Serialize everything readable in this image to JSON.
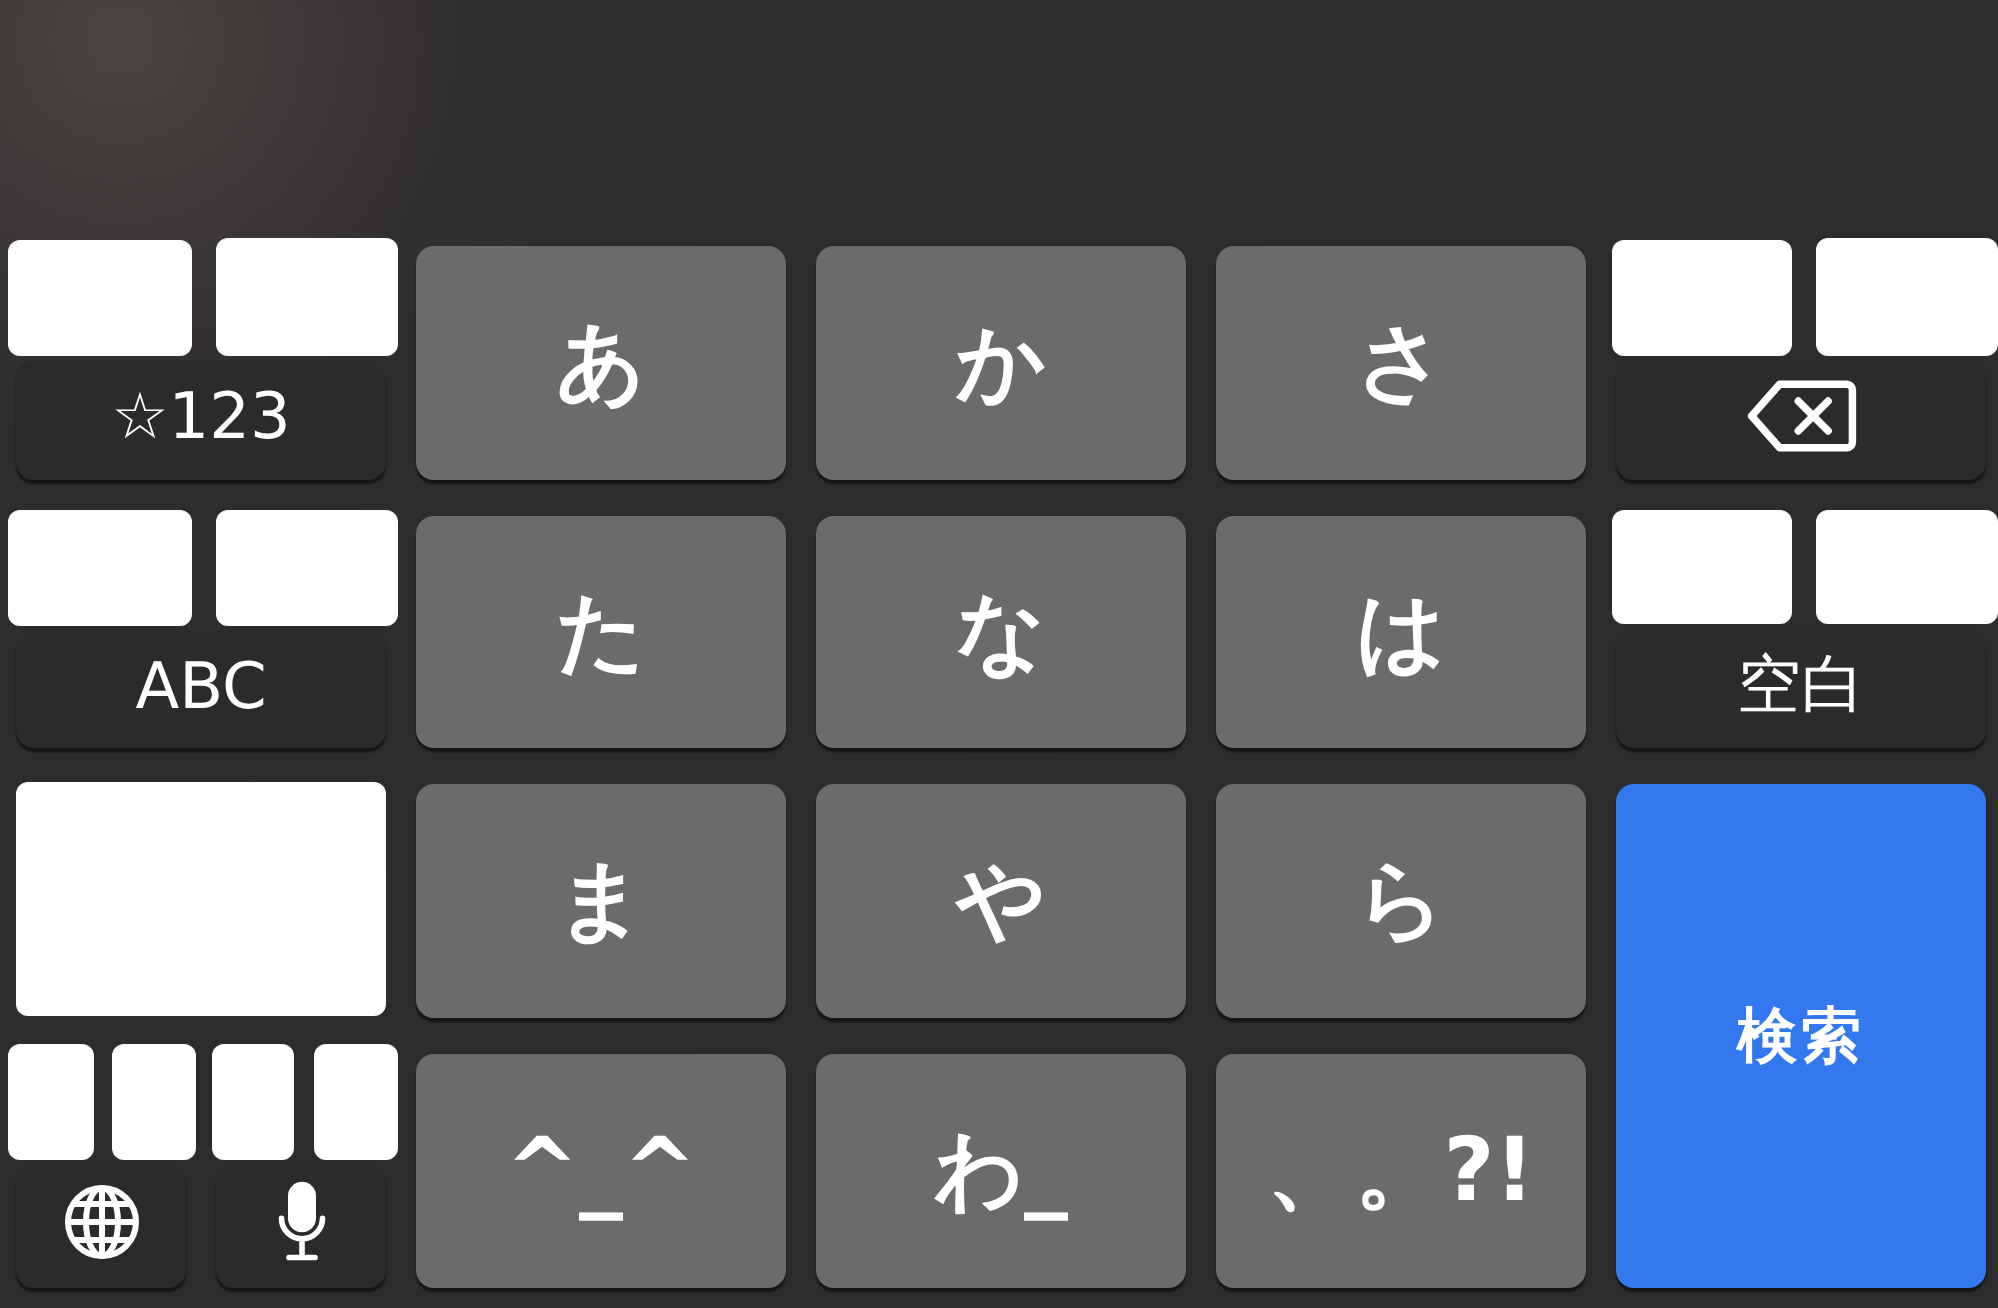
{
  "keyboard": {
    "rows": [
      [
        {
          "kind": "function",
          "label": "☆123"
        },
        {
          "kind": "char",
          "label": "あ"
        },
        {
          "kind": "char",
          "label": "か"
        },
        {
          "kind": "char",
          "label": "さ"
        },
        {
          "kind": "delete"
        }
      ],
      [
        {
          "kind": "function",
          "label": "ABC"
        },
        {
          "kind": "char",
          "label": "た"
        },
        {
          "kind": "char",
          "label": "な"
        },
        {
          "kind": "char",
          "label": "は"
        },
        {
          "kind": "function",
          "label": "空白"
        }
      ],
      [
        {
          "kind": "covered"
        },
        {
          "kind": "char",
          "label": "ま"
        },
        {
          "kind": "char",
          "label": "や"
        },
        {
          "kind": "char",
          "label": "ら"
        },
        {
          "kind": "enter",
          "label": "検索"
        }
      ],
      [
        {
          "kind": "pair",
          "keys": [
            {
              "kind": "globe"
            },
            {
              "kind": "mic"
            }
          ]
        },
        {
          "kind": "char",
          "label": "^_^"
        },
        {
          "kind": "char",
          "label": "わ_"
        },
        {
          "kind": "char",
          "label": "、。?!"
        }
      ]
    ]
  }
}
